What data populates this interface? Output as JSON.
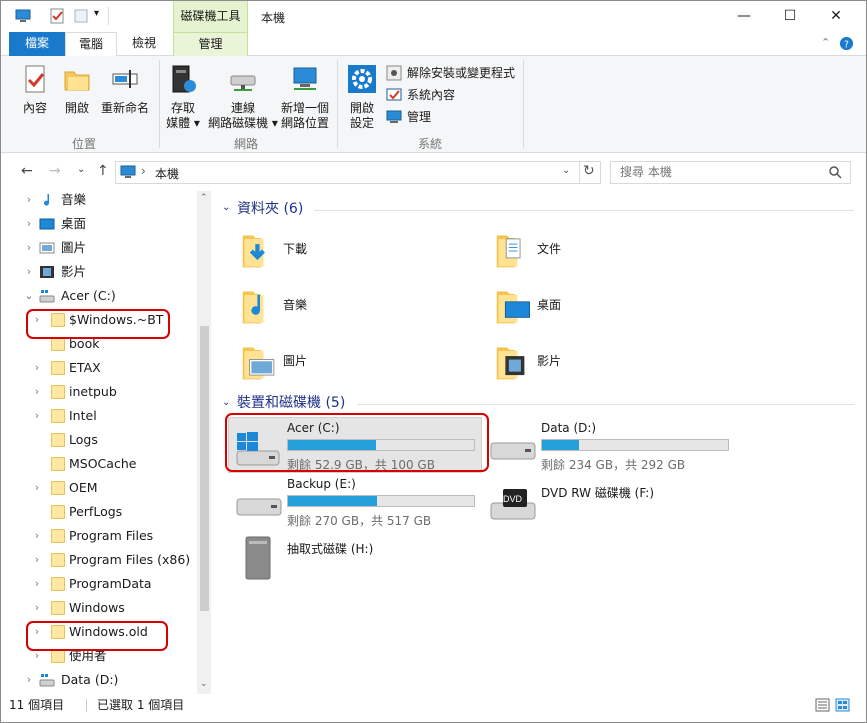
{
  "title": {
    "context_tool": "磁碟機工具",
    "window_title": "本機",
    "minimize": "—",
    "maximize": "☐",
    "close": "✕"
  },
  "tabs": [
    "檔案",
    "電腦",
    "檢視",
    "管理"
  ],
  "ribbon": {
    "location": {
      "group_label": "位置",
      "buttons": [
        "內容",
        "開啟",
        "重新命名"
      ]
    },
    "network": {
      "group_label": "網路",
      "buttons": [
        {
          "line1": "存取",
          "line2": "媒體 ▾"
        },
        {
          "line1": "連線",
          "line2": "網路磁碟機 ▾"
        },
        {
          "line1": "新增一個",
          "line2": "網路位置"
        }
      ]
    },
    "system": {
      "group_label": "系統",
      "open_settings": {
        "line1": "開啟",
        "line2": "設定"
      },
      "small": [
        "解除安裝或變更程式",
        "系統內容",
        "管理"
      ]
    }
  },
  "address": {
    "path": "本機",
    "search_placeholder": "搜尋 本機"
  },
  "nav_tree": [
    {
      "label": "音樂",
      "icon": "music-note-icon",
      "chevron": "›"
    },
    {
      "label": "桌面",
      "icon": "desktop-icon",
      "chevron": "›"
    },
    {
      "label": "圖片",
      "icon": "pictures-icon",
      "chevron": "›"
    },
    {
      "label": "影片",
      "icon": "videos-icon",
      "chevron": "›"
    },
    {
      "label": "Acer (C:)",
      "icon": "drive-icon",
      "chevron": "⌄"
    },
    {
      "label": "$Windows.~BT",
      "icon": "folder-icon",
      "chevron": "›"
    },
    {
      "label": "book",
      "icon": "folder-icon",
      "chevron": ""
    },
    {
      "label": "ETAX",
      "icon": "folder-icon",
      "chevron": "›"
    },
    {
      "label": "inetpub",
      "icon": "folder-icon",
      "chevron": "›"
    },
    {
      "label": "Intel",
      "icon": "folder-icon",
      "chevron": "›"
    },
    {
      "label": "Logs",
      "icon": "folder-icon",
      "chevron": ""
    },
    {
      "label": "MSOCache",
      "icon": "folder-icon",
      "chevron": ""
    },
    {
      "label": "OEM",
      "icon": "folder-icon",
      "chevron": "›"
    },
    {
      "label": "PerfLogs",
      "icon": "folder-icon",
      "chevron": ""
    },
    {
      "label": "Program Files",
      "icon": "folder-icon",
      "chevron": "›"
    },
    {
      "label": "Program Files (x86)",
      "icon": "folder-icon",
      "chevron": "›"
    },
    {
      "label": "ProgramData",
      "icon": "folder-icon",
      "chevron": "›"
    },
    {
      "label": "Windows",
      "icon": "folder-icon",
      "chevron": "›"
    },
    {
      "label": "Windows.old",
      "icon": "folder-icon",
      "chevron": "›"
    },
    {
      "label": "使用者",
      "icon": "folder-icon",
      "chevron": "›"
    },
    {
      "label": "Data (D:)",
      "icon": "drive-icon",
      "chevron": "›"
    }
  ],
  "content": {
    "folders_header": "資料夾 (6)",
    "folders": [
      "下載",
      "文件",
      "音樂",
      "桌面",
      "圖片",
      "影片"
    ],
    "devices_header": "裝置和磁碟機 (5)",
    "drives": [
      {
        "name": "Acer (C:)",
        "free": "剩餘 52.9 GB，共 100 GB",
        "used_fraction": 0.471
      },
      {
        "name": "Data (D:)",
        "free": "剩餘 234 GB，共 292 GB",
        "used_fraction": 0.199
      },
      {
        "name": "Backup (E:)",
        "free": "剩餘 270 GB，共 517 GB",
        "used_fraction": 0.478
      }
    ],
    "dvd": {
      "name": "DVD RW 磁碟機 (F:)",
      "badge": "DVD"
    },
    "removable": {
      "name": "抽取式磁碟 (H:)"
    }
  },
  "status": {
    "count": "11 個項目",
    "selected": "已選取 1 個項目"
  },
  "colors": {
    "accent": "#1979ca",
    "progress": "#26a0da",
    "highlight": "#d60000",
    "context_tab": "#e6f3d0"
  }
}
